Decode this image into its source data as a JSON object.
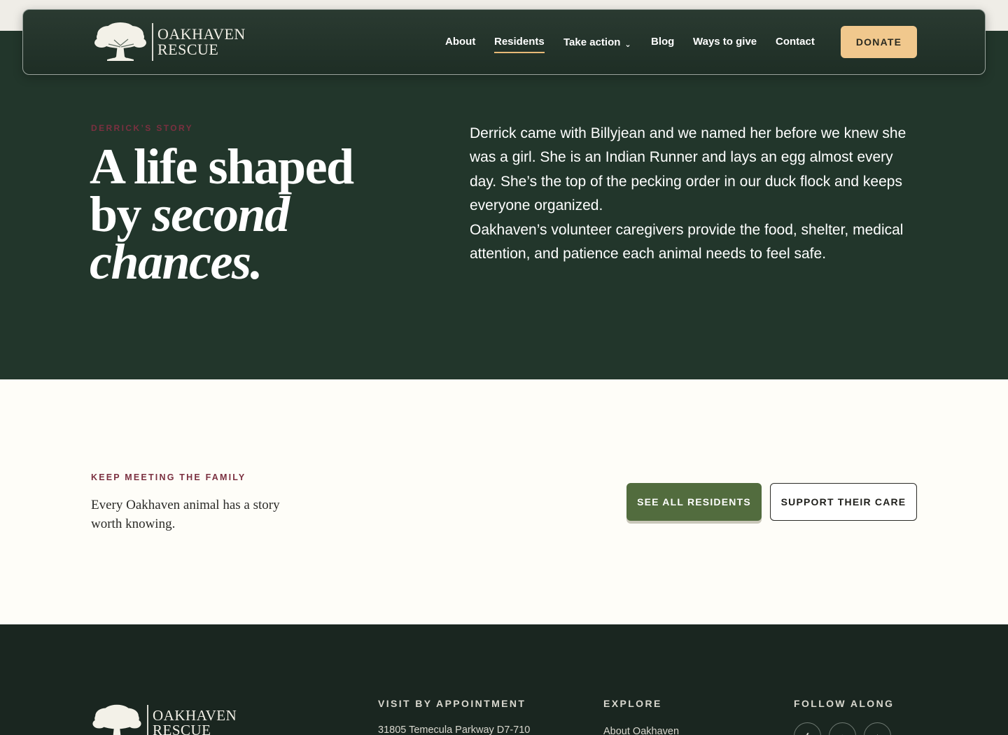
{
  "brand": {
    "name_line1": "OAKHAVEN",
    "name_line2": "RESCUE"
  },
  "nav": {
    "items": [
      {
        "label": "About"
      },
      {
        "label": "Residents"
      },
      {
        "label": "Take action",
        "icon": "chevron-down-icon"
      },
      {
        "label": "Blog"
      },
      {
        "label": "Ways to give"
      },
      {
        "label": "Contact"
      }
    ],
    "active": "Residents",
    "donate_label": "DONATE"
  },
  "hero": {
    "eyebrow": "DERRICK’S STORY",
    "headline_line1": "A life shaped",
    "headline_line2_plain": "by ",
    "headline_line2_italic": "second",
    "headline_line3_italic": "chances.",
    "body_p1": "Derrick came with Billyjean and we named her before we knew she was a girl. She is an Indian Runner and lays an egg almost every day. She’s the top of the pecking order in our duck flock and keeps everyone organized.",
    "body_p2": "Oakhaven’s volunteer caregivers provide the food, shelter, medical attention, and patience each animal needs to feel safe."
  },
  "family": {
    "eyebrow": "KEEP MEETING THE FAMILY",
    "text": "Every Oakhaven animal has a story worth knowing.",
    "primary_button": "SEE ALL RESIDENTS",
    "secondary_button": "SUPPORT THEIR CARE"
  },
  "footer": {
    "visit_heading": "VISIT BY APPOINTMENT",
    "address_line1": "31805 Temecula Parkway D7-710",
    "explore_heading": "EXPLORE",
    "explore_link1": "About Oakhaven",
    "follow_heading": "FOLLOW ALONG",
    "social": [
      "facebook-icon",
      "instagram-icon",
      "tiktok-icon"
    ]
  },
  "colors": {
    "hero_bg": "#22362b",
    "accent_gold": "#f1c88d",
    "eyebrow_wine": "#7b3040",
    "primary_green": "#526c3e",
    "footer_bg": "#1a2620"
  }
}
